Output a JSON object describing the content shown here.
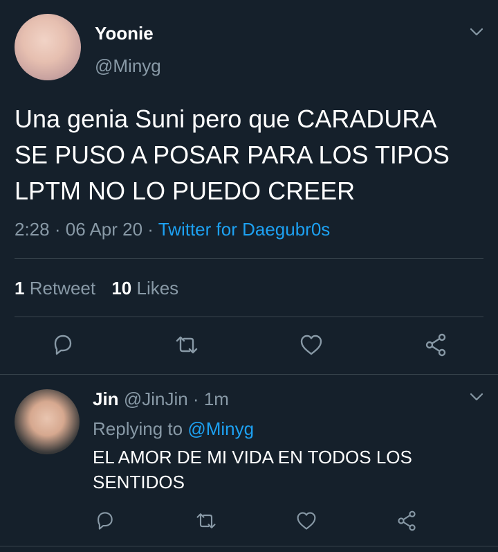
{
  "tweet": {
    "display_name": "Yoonie",
    "handle": "@Minyg",
    "text_lines": [
      "Una genia Suni pero que CARADURA",
      "SE PUSO A POSAR PARA LOS TIPOS",
      "LPTM NO LO PUEDO CREER"
    ],
    "time": "2:28",
    "sep1": "·",
    "date": "06 Apr 20",
    "sep2": "·",
    "source": "Twitter for Daegubr0s",
    "retweets_count": "1",
    "retweets_label": "Retweet",
    "likes_count": "10",
    "likes_label": "Likes"
  },
  "reply": {
    "display_name": "Jin",
    "handle": "@JinJin",
    "sep": "·",
    "age": "1m",
    "replying_prefix": "Replying to",
    "replying_to": "@Minyg",
    "text_lines": [
      "EL AMOR DE MI VIDA EN TODOS LOS",
      "SENTIDOS"
    ]
  },
  "icons": {
    "reply": "reply-icon",
    "retweet": "retweet-icon",
    "like": "heart-icon",
    "share": "share-icon",
    "menu": "chevron-down-icon"
  },
  "colors": {
    "background": "#15202b",
    "secondary_text": "#8899a6",
    "link": "#1da1f2",
    "divider": "#38444d"
  }
}
